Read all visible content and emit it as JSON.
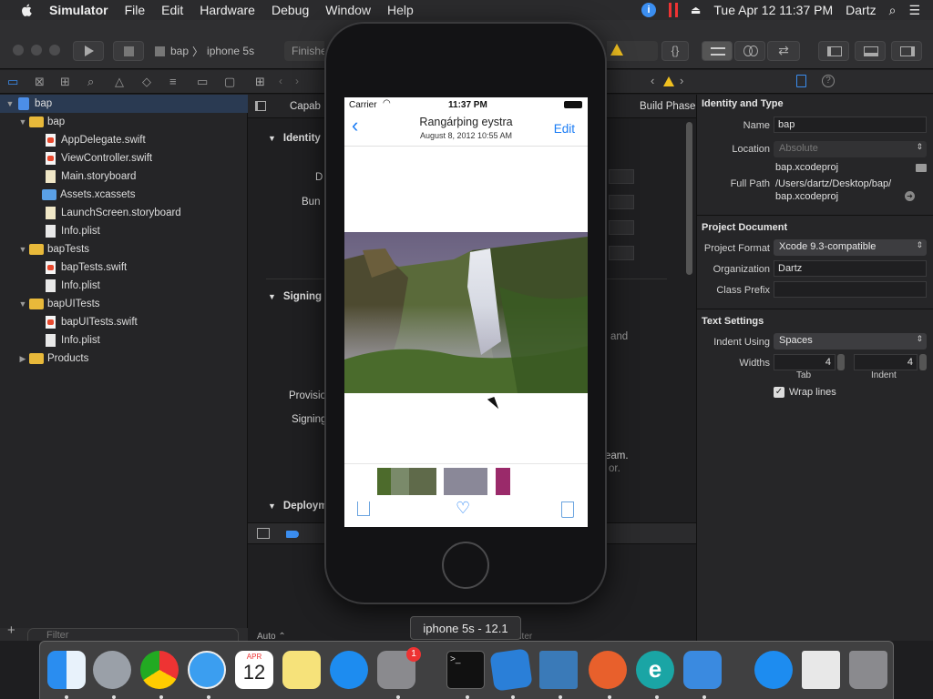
{
  "menubar": {
    "app": "Simulator",
    "items": [
      "File",
      "Edit",
      "Hardware",
      "Debug",
      "Window",
      "Help"
    ],
    "clock": "Tue Apr 12  11:37 PM",
    "user": "Dartz"
  },
  "toolbar": {
    "scheme": "bap",
    "device": "iphone 5s",
    "status": "Finishe"
  },
  "navigator": {
    "items": [
      {
        "label": "bap",
        "type": "project",
        "indent": 0,
        "disclosure": "▼"
      },
      {
        "label": "bap",
        "type": "folder",
        "indent": 1,
        "disclosure": "▼"
      },
      {
        "label": "AppDelegate.swift",
        "type": "swift",
        "indent": 2
      },
      {
        "label": "ViewController.swift",
        "type": "swift",
        "indent": 2
      },
      {
        "label": "Main.storyboard",
        "type": "storyboard",
        "indent": 2
      },
      {
        "label": "Assets.xcassets",
        "type": "assets",
        "indent": 2
      },
      {
        "label": "LaunchScreen.storyboard",
        "type": "storyboard",
        "indent": 2
      },
      {
        "label": "Info.plist",
        "type": "plist",
        "indent": 2
      },
      {
        "label": "bapTests",
        "type": "folder",
        "indent": 1,
        "disclosure": "▼"
      },
      {
        "label": "bapTests.swift",
        "type": "swift",
        "indent": 2
      },
      {
        "label": "Info.plist",
        "type": "plist",
        "indent": 2
      },
      {
        "label": "bapUITests",
        "type": "folder",
        "indent": 1,
        "disclosure": "▼"
      },
      {
        "label": "bapUITests.swift",
        "type": "swift",
        "indent": 2
      },
      {
        "label": "Info.plist",
        "type": "plist",
        "indent": 2
      },
      {
        "label": "Products",
        "type": "folder",
        "indent": 1,
        "disclosure": "▶"
      }
    ],
    "filter_placeholder": "Filter"
  },
  "editor": {
    "tab_capabilities": "Capab",
    "tab_build_phases": "Build Phase",
    "section_identity": "Identity",
    "label_d": "D",
    "label_bun": "Bun",
    "section_signing": "Signing",
    "label_provisio": "Provisio",
    "label_signing": "Signing",
    "section_deploy": "Deploym",
    "text_and": "and",
    "text_eam": "eam.",
    "text_or": "or.",
    "auto_label": "Auto ⌃",
    "filter2_placeholder": "Filter"
  },
  "inspector": {
    "identity_header": "Identity and Type",
    "name_label": "Name",
    "name_value": "bap",
    "location_label": "Location",
    "location_value": "Absolute",
    "filename": "bap.xcodeproj",
    "fullpath_label": "Full Path",
    "fullpath_value_1": "/Users/dartz/Desktop/bap/",
    "fullpath_value_2": "bap.xcodeproj",
    "project_doc_header": "Project Document",
    "project_format_label": "Project Format",
    "project_format_value": "Xcode 9.3-compatible",
    "organization_label": "Organization",
    "organization_value": "Dartz",
    "class_prefix_label": "Class Prefix",
    "class_prefix_value": "",
    "text_settings_header": "Text Settings",
    "indent_using_label": "Indent Using",
    "indent_using_value": "Spaces",
    "widths_label": "Widths",
    "tab_value": "4",
    "indent_value": "4",
    "tab_caption": "Tab",
    "indent_caption": "Indent",
    "wrap_lines_label": "Wrap lines"
  },
  "simulator": {
    "carrier": "Carrier",
    "time": "11:37 PM",
    "title": "Rangárþing eystra",
    "subtitle": "August 8, 2012  10:55 AM",
    "edit_label": "Edit",
    "device_label": "iphone 5s - 12.1"
  },
  "dock": {
    "items": [
      "finder-icon",
      "launchpad-icon",
      "chrome-icon",
      "safari-icon",
      "calendar-icon",
      "notes-icon",
      "app-store-icon",
      "system-preferences-icon",
      "terminal-icon",
      "xcode-icon",
      "remote-desktop-icon",
      "ubuntu-icon",
      "eset-icon",
      "simulator-icon",
      "app-store-2-icon",
      "preview-icon",
      "trash-icon"
    ],
    "calendar_month": "APR",
    "calendar_day": "12",
    "sysprefs_badge": "1"
  }
}
